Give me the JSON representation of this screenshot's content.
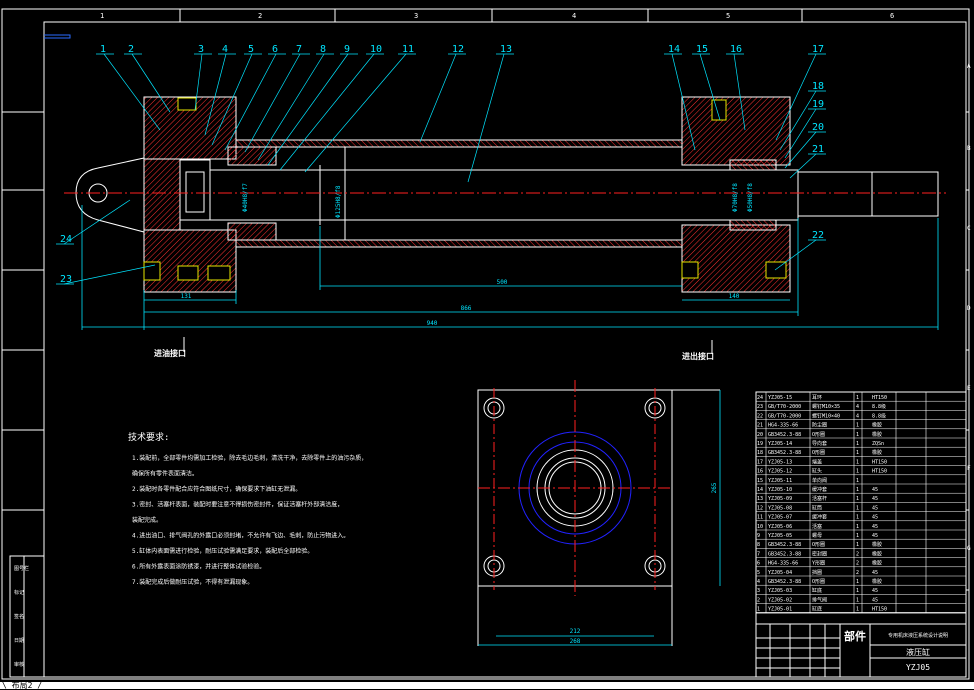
{
  "colors": {
    "background": "#000000",
    "frame": "#ffffff",
    "outline": "#ffffff",
    "centerline": "#ff2020",
    "hatch": "#ff3030",
    "dimension": "#00e5ff",
    "leader": "#00e5ff",
    "table_text": "#ffffff",
    "title_text": "#ffffff",
    "port": "#e6e600",
    "flange_circle": "#2222ff"
  },
  "zones": {
    "columns": [
      "1",
      "2",
      "3",
      "4",
      "5",
      "6"
    ],
    "rows": [
      "A",
      "B",
      "C",
      "D",
      "E",
      "F",
      "G"
    ]
  },
  "part_numbers": [
    "1",
    "2",
    "3",
    "4",
    "5",
    "6",
    "7",
    "8",
    "9",
    "10",
    "11",
    "12",
    "13",
    "14",
    "15",
    "16",
    "17",
    "18",
    "19",
    "20",
    "21",
    "22",
    "23",
    "24"
  ],
  "dimensions": {
    "d1": "131",
    "d2": "500",
    "d3": "866",
    "d4": "940",
    "d5": "140",
    "bore_left": "Φ40H8/f7",
    "bore_mid": "Φ125H8/f8",
    "bore_right_a": "Φ70H8/f8",
    "bore_right_b": "Φ50H8/f8",
    "flange_w1": "212",
    "flange_w2": "268",
    "flange_h": "265"
  },
  "ports": {
    "inlet": "进油接口",
    "outlet": "进出接口"
  },
  "notes": {
    "title": "技术要求:",
    "items": [
      "1.装配前，全部零件均需加工检验，除去毛边毛刺，清洗干净，去除零件上的油污杂质，",
      "  确保所有零件表面清洁。",
      "2.装配时各零件配合应符合图纸尺寸，确保要求下油缸无泄漏。",
      "3.密封、活塞杆表面，装配时要注意不得损伤密封件，保证活塞杆外部清洁度，",
      "  装配完成。",
      "4.进出油口、排气阀孔的外露口必须封堵，不允许有飞边、毛刺，防止污物进入。",
      "5.缸体内表面需进行检验，耐压试验需满足要求，装配后全部检验。",
      "6.所有外露表面涂防锈漆，并进行整体试验检验。",
      "7.装配完成后做耐压试验，不得有泄漏现象。"
    ]
  },
  "parts_table": {
    "rows": [
      {
        "no": "24",
        "code": "YZJ05-15",
        "name": "耳环",
        "qty": "1",
        "mat": "HT150"
      },
      {
        "no": "23",
        "code": "GB/T70-2000",
        "name": "螺钉M10×35",
        "qty": "4",
        "mat": "8.8级"
      },
      {
        "no": "22",
        "code": "GB/T70-2000",
        "name": "螺钉M10×40",
        "qty": "4",
        "mat": "8.8级"
      },
      {
        "no": "21",
        "code": "HG4-335-66",
        "name": "防尘圈",
        "qty": "1",
        "mat": "橡胶"
      },
      {
        "no": "20",
        "code": "GB3452.3-88",
        "name": "O形圈",
        "qty": "1",
        "mat": "橡胶"
      },
      {
        "no": "19",
        "code": "YZJ05-14",
        "name": "导向套",
        "qty": "1",
        "mat": "ZQSn"
      },
      {
        "no": "18",
        "code": "GB3452.3-88",
        "name": "O形圈",
        "qty": "1",
        "mat": "橡胶"
      },
      {
        "no": "17",
        "code": "YZJ05-13",
        "name": "端盖",
        "qty": "1",
        "mat": "HT150"
      },
      {
        "no": "16",
        "code": "YZJ05-12",
        "name": "缸头",
        "qty": "1",
        "mat": "HT150"
      },
      {
        "no": "15",
        "code": "YZJ05-11",
        "name": "单向阀",
        "qty": "1",
        "mat": ""
      },
      {
        "no": "14",
        "code": "YZJ05-10",
        "name": "缓冲套",
        "qty": "1",
        "mat": "45"
      },
      {
        "no": "13",
        "code": "YZJ05-09",
        "name": "活塞杆",
        "qty": "1",
        "mat": "45"
      },
      {
        "no": "12",
        "code": "YZJ05-08",
        "name": "缸筒",
        "qty": "1",
        "mat": "45"
      },
      {
        "no": "11",
        "code": "YZJ05-07",
        "name": "缓冲套",
        "qty": "1",
        "mat": "45"
      },
      {
        "no": "10",
        "code": "YZJ05-06",
        "name": "活塞",
        "qty": "1",
        "mat": "45"
      },
      {
        "no": "9",
        "code": "YZJ05-05",
        "name": "螺母",
        "qty": "1",
        "mat": "45"
      },
      {
        "no": "8",
        "code": "GB3452.3-88",
        "name": "O形圈",
        "qty": "1",
        "mat": "橡胶"
      },
      {
        "no": "7",
        "code": "GB3452.3-88",
        "name": "密封圈",
        "qty": "2",
        "mat": "橡胶"
      },
      {
        "no": "6",
        "code": "HG4-335-66",
        "name": "Y形圈",
        "qty": "2",
        "mat": "橡胶"
      },
      {
        "no": "5",
        "code": "YZJ05-04",
        "name": "挡圈",
        "qty": "2",
        "mat": "45"
      },
      {
        "no": "4",
        "code": "GB3452.3-88",
        "name": "O形圈",
        "qty": "1",
        "mat": "橡胶"
      },
      {
        "no": "3",
        "code": "YZJ05-03",
        "name": "缸底",
        "qty": "1",
        "mat": "45"
      },
      {
        "no": "2",
        "code": "YZJ05-02",
        "name": "排气阀",
        "qty": "1",
        "mat": "45"
      },
      {
        "no": "1",
        "code": "YZJ05-01",
        "name": "缸底",
        "qty": "1",
        "mat": "HT150"
      }
    ]
  },
  "title_block": {
    "label": "部件",
    "project": "专用机床液压系统设计说明",
    "drawing_name": "液压缸",
    "drawing_no": "YZJ05"
  },
  "side_panel": {
    "labels": [
      "图号栏",
      "标记",
      "签名",
      "日期",
      "审核"
    ]
  },
  "status": {
    "text": "\\ 布局2 /"
  }
}
